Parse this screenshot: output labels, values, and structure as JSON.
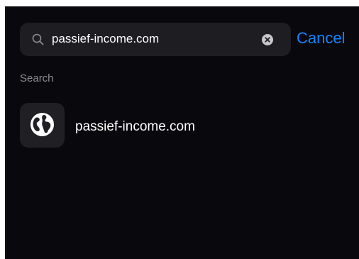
{
  "search": {
    "query": "passief-income.com",
    "search_icon": "search-icon",
    "clear_icon": "clear-icon"
  },
  "header": {
    "cancel_label": "Cancel"
  },
  "results": {
    "section_label": "Search",
    "items": [
      {
        "label": "passief-income.com",
        "icon": "globe-icon"
      }
    ]
  },
  "colors": {
    "background": "#08080d",
    "field": "#1d1d22",
    "accent": "#1584ff",
    "secondary_text": "#8e8e93",
    "primary_text": "#ffffff"
  }
}
